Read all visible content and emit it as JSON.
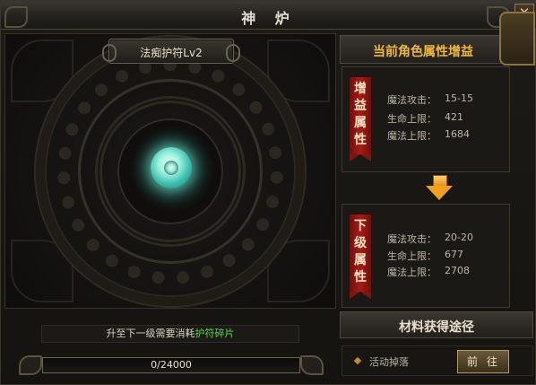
{
  "window": {
    "title": "神 炉",
    "close_label": "✕"
  },
  "amulet": {
    "name": "法痴护符Lv2"
  },
  "upgrade": {
    "requirement_prefix": "升至下一级需要消耗",
    "requirement_item": "护符碎片",
    "progress_text": "0/24000",
    "progress_fraction": 0
  },
  "bonus": {
    "header": "当前角色属性增益",
    "current": {
      "ribbon": "增益属性",
      "stats": [
        {
          "label": "魔法攻击：",
          "value": "15-15"
        },
        {
          "label": "生命上限：",
          "value": "421"
        },
        {
          "label": "魔法上限：",
          "value": "1684"
        }
      ]
    },
    "next": {
      "ribbon": "下级属性",
      "stats": [
        {
          "label": "魔法攻击：",
          "value": "20-20"
        },
        {
          "label": "生命上限：",
          "value": "677"
        },
        {
          "label": "魔法上限：",
          "value": "2708"
        }
      ]
    }
  },
  "materials": {
    "header": "材料获得途径",
    "items": [
      {
        "label": "活动掉落",
        "button": "前往"
      }
    ]
  },
  "colors": {
    "accent": "#f0b840",
    "highlight_green": "#5fd24a",
    "ribbon_red": "#a81c14"
  }
}
